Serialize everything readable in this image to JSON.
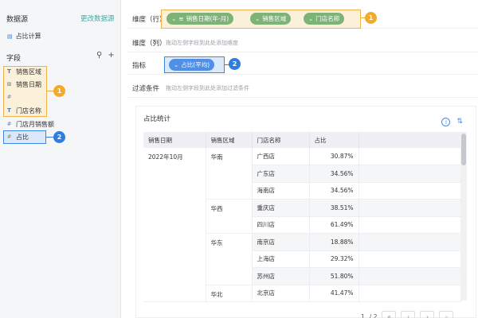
{
  "datasource": {
    "title": "数据源",
    "change_label": "更改数据源",
    "item": "占比计算"
  },
  "fields": {
    "heading": "字段",
    "items": [
      {
        "label": "销售区域",
        "icon": "text-type-icon",
        "glyph": "T"
      },
      {
        "label": "销售日期",
        "icon": "date-type-icon",
        "glyph": "⊞"
      },
      {
        "label": "",
        "icon": "number-type-icon",
        "glyph": "#"
      },
      {
        "label": "门店名称",
        "icon": "text-type-icon",
        "glyph": "T"
      },
      {
        "label": "门店月销售额",
        "icon": "number-type-icon",
        "glyph": "#"
      },
      {
        "label": "占比",
        "icon": "number-type-icon",
        "glyph": "#"
      }
    ]
  },
  "config": {
    "dimension_row_label": "维度（行）",
    "dimension_row_pills": [
      "销售日期(年-月)",
      "销售区域",
      "门店名称"
    ],
    "dimension_col_label": "维度（列）",
    "dimension_col_hint": "拖动左侧字段到此处添加维度",
    "metric_label": "指标",
    "metric_pill": "占比(平均)",
    "filter_label": "过滤条件",
    "filter_hint": "拖动左侧字段到此处添加过滤条件"
  },
  "badges": {
    "one": "1",
    "two": "2"
  },
  "colors": {
    "accent_green": "#7eb377",
    "accent_blue": "#4f8fe6",
    "highlight_orange": "#f0b246",
    "link": "#43a9a0"
  },
  "table": {
    "title": "占比统计",
    "headers": [
      "销售日期",
      "销售区域",
      "门店名称",
      "占比"
    ],
    "date": "2022年10月",
    "groups": [
      {
        "region": "华南",
        "rows": [
          [
            "广西店",
            "30.87%"
          ],
          [
            "广东店",
            "34.56%"
          ],
          [
            "海南店",
            "34.56%"
          ]
        ]
      },
      {
        "region": "华西",
        "rows": [
          [
            "重庆店",
            "38.51%"
          ],
          [
            "四川店",
            "61.49%"
          ]
        ]
      },
      {
        "region": "华东",
        "rows": [
          [
            "南京店",
            "18.88%"
          ],
          [
            "上海店",
            "29.32%"
          ],
          [
            "苏州店",
            "51.80%"
          ]
        ]
      },
      {
        "region": "华北",
        "rows": [
          [
            "北京店",
            "41.47%"
          ]
        ]
      }
    ]
  },
  "pager": {
    "page": "1",
    "total": "/ 2"
  }
}
